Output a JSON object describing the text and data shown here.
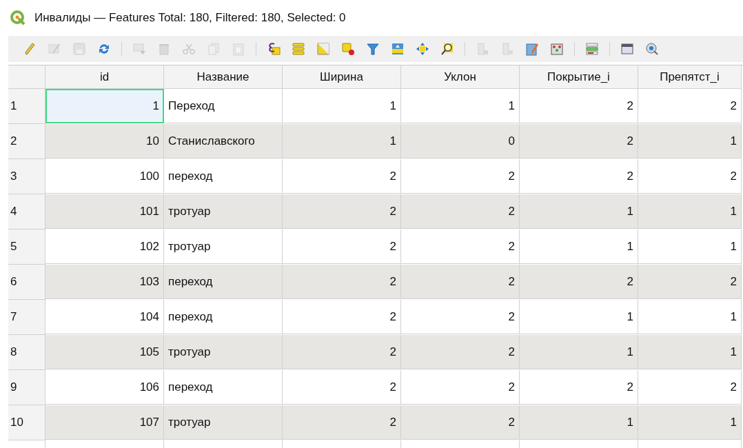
{
  "window": {
    "title": "Инвалиды — Features Total: 180, Filtered: 180, Selected: 0"
  },
  "toolbar": [
    {
      "kind": "pencil",
      "disabled": false
    },
    {
      "kind": "editsheet",
      "disabled": true
    },
    {
      "kind": "save",
      "disabled": true
    },
    {
      "kind": "refresh",
      "disabled": false
    },
    {
      "kind": "separator"
    },
    {
      "kind": "addrow",
      "disabled": true
    },
    {
      "kind": "trash",
      "disabled": true
    },
    {
      "kind": "scissors",
      "disabled": true
    },
    {
      "kind": "copy",
      "disabled": true
    },
    {
      "kind": "paste",
      "disabled": true
    },
    {
      "kind": "separator"
    },
    {
      "kind": "expression",
      "disabled": false
    },
    {
      "kind": "selectall",
      "disabled": false
    },
    {
      "kind": "invert",
      "disabled": false
    },
    {
      "kind": "deselect",
      "disabled": false
    },
    {
      "kind": "filter",
      "disabled": false
    },
    {
      "kind": "movetop",
      "disabled": false
    },
    {
      "kind": "pan",
      "disabled": false
    },
    {
      "kind": "zoom",
      "disabled": false
    },
    {
      "kind": "separator"
    },
    {
      "kind": "newfield",
      "disabled": true
    },
    {
      "kind": "deletefield",
      "disabled": true
    },
    {
      "kind": "calculator",
      "disabled": false
    },
    {
      "kind": "conditional",
      "disabled": false
    },
    {
      "kind": "separator"
    },
    {
      "kind": "actions",
      "disabled": false
    },
    {
      "kind": "separator"
    },
    {
      "kind": "dock",
      "disabled": false
    },
    {
      "kind": "zoomto",
      "disabled": false
    }
  ],
  "table": {
    "columns": [
      "id",
      "Название",
      "Ширина",
      "Уклон",
      "Покрытие_i",
      "Препятст_i"
    ],
    "rows": [
      {
        "header": "1",
        "cells": [
          "1",
          "Переход",
          "1",
          "1",
          "2",
          "2"
        ],
        "current": true
      },
      {
        "header": "2",
        "cells": [
          "10",
          "Станиславского",
          "1",
          "0",
          "2",
          "1"
        ],
        "current": false
      },
      {
        "header": "3",
        "cells": [
          "100",
          "переход",
          "2",
          "2",
          "2",
          "2"
        ],
        "current": false
      },
      {
        "header": "4",
        "cells": [
          "101",
          "тротуар",
          "2",
          "2",
          "1",
          "1"
        ],
        "current": false
      },
      {
        "header": "5",
        "cells": [
          "102",
          "тротуар",
          "2",
          "2",
          "1",
          "1"
        ],
        "current": false
      },
      {
        "header": "6",
        "cells": [
          "103",
          "переход",
          "2",
          "2",
          "2",
          "2"
        ],
        "current": false
      },
      {
        "header": "7",
        "cells": [
          "104",
          "переход",
          "2",
          "2",
          "1",
          "1"
        ],
        "current": false
      },
      {
        "header": "8",
        "cells": [
          "105",
          "тротуар",
          "2",
          "2",
          "1",
          "1"
        ],
        "current": false
      },
      {
        "header": "9",
        "cells": [
          "106",
          "переход",
          "2",
          "2",
          "2",
          "2"
        ],
        "current": false
      },
      {
        "header": "10",
        "cells": [
          "107",
          "тротуар",
          "2",
          "2",
          "1",
          "1"
        ],
        "current": false
      }
    ]
  }
}
